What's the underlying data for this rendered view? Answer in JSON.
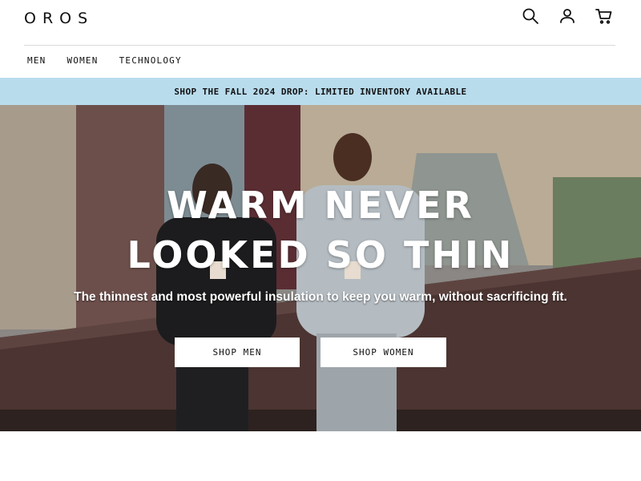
{
  "header": {
    "logo": "OROS",
    "icons": [
      "search-icon",
      "account-icon",
      "cart-icon"
    ]
  },
  "nav": {
    "items": [
      "MEN",
      "WOMEN",
      "TECHNOLOGY"
    ]
  },
  "promo": {
    "text": "SHOP THE FALL 2024 DROP: LIMITED INVENTORY AVAILABLE",
    "color": "#b9dced"
  },
  "hero": {
    "title_line1": "WARM NEVER",
    "title_line2": "LOOKED SO THIN",
    "subtitle": "The thinnest and most powerful insulation to keep you warm, without sacrificing fit.",
    "cta_men": "SHOP MEN",
    "cta_women": "SHOP WOMEN"
  }
}
